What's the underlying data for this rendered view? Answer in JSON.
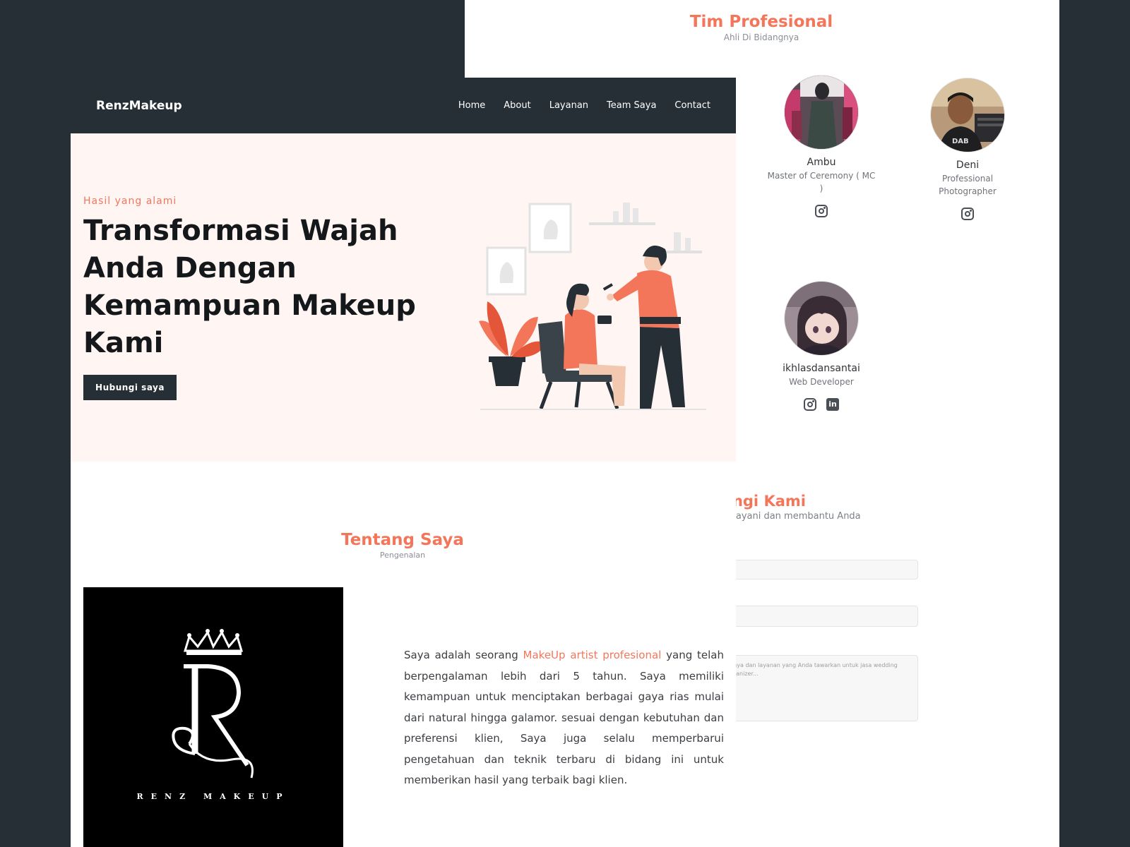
{
  "team": {
    "title": "Tim Profesional",
    "subtitle": "Ahli Di Bidangnya",
    "members": [
      {
        "name": "Ambu",
        "role": "Master of Ceremony ( MC )"
      },
      {
        "name": "Deni",
        "role": "Professional Photographer"
      },
      {
        "name": "ikhlasdansantai",
        "role": "Web Developer"
      }
    ]
  },
  "contact": {
    "title": "ungi Kami",
    "subtitle": "nelayani dan membantu Anda",
    "message_placeholder": "akaya dan layanan yang Anda tawarkan untuk jasa wedding organizer..."
  },
  "navbar": {
    "brand": "RenzMakeup",
    "links": [
      "Home",
      "About",
      "Layanan",
      "Team Saya",
      "Contact"
    ]
  },
  "hero": {
    "kicker": "Hasil yang alami",
    "title": "Transformasi Wajah Anda Dengan Kemampuan Makeup Kami",
    "button": "Hubungi saya"
  },
  "about": {
    "title": "Tentang Saya",
    "subtitle": "Pengenalan",
    "logo_text": "RENZ MAKEUP",
    "text_before": "Saya adalah seorang ",
    "text_highlight": "MakeUp artist profesional",
    "text_after": " yang telah berpengalaman lebih dari 5 tahun. Saya memiliki kemampuan untuk menciptakan berbagai gaya rias mulai dari natural hingga galamor. sesuai dengan kebutuhan dan preferensi klien, Saya juga selalu memperbarui pengetahuan dan teknik terbaru di bidang ini untuk memberikan hasil yang terbaik bagi klien."
  },
  "colors": {
    "accent": "#f4765a",
    "dark": "#262f35",
    "hero_bg": "#fff5f3"
  }
}
